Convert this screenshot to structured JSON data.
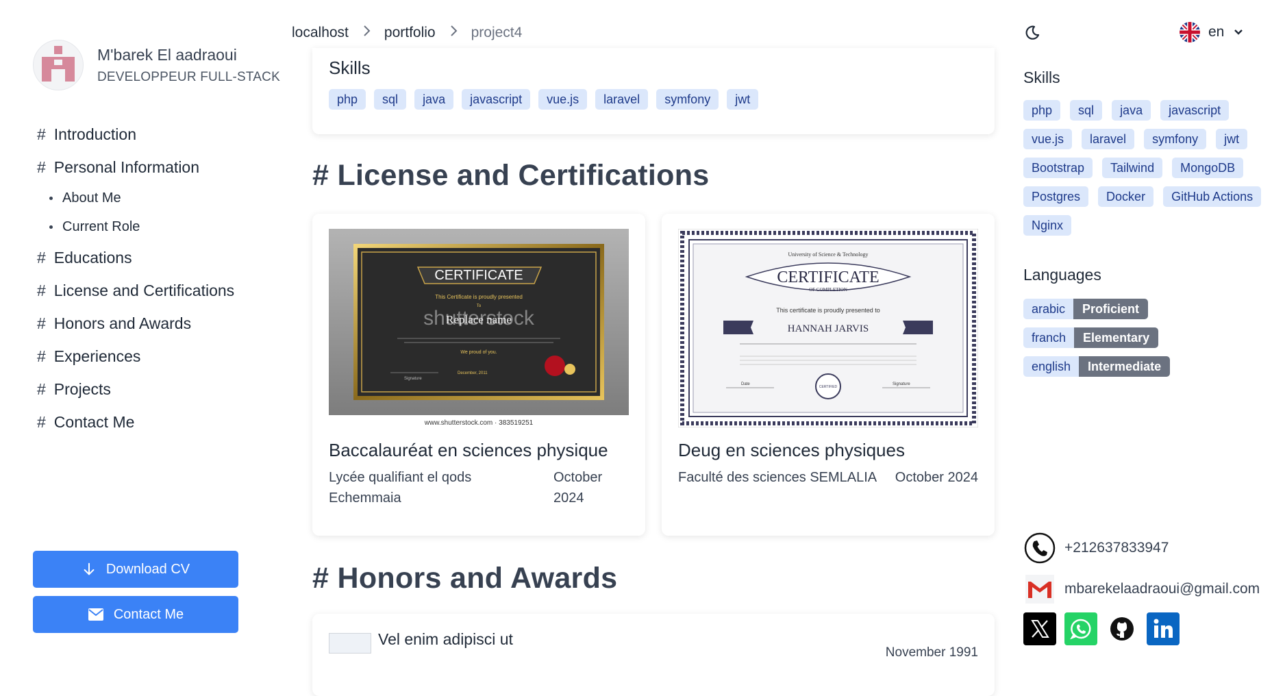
{
  "profile": {
    "name": "M'barek El aadraoui",
    "role": "DEVELOPPEUR FULL-STACK"
  },
  "nav": {
    "introduction": "Introduction",
    "personal_information": "Personal Information",
    "about_me": "About Me",
    "current_role": "Current Role",
    "educations": "Educations",
    "license": "License and Certifications",
    "honors": "Honors and Awards",
    "experiences": "Experiences",
    "projects": "Projects",
    "contact": "Contact Me",
    "hash": "#"
  },
  "buttons": {
    "download_cv": "Download CV",
    "contact_me": "Contact Me"
  },
  "breadcrumb": [
    "localhost",
    "portfolio",
    "project4"
  ],
  "language_selector": {
    "label": "en"
  },
  "main": {
    "skills_title": "Skills",
    "skills": [
      "php",
      "sql",
      "java",
      "javascript",
      "vue.js",
      "laravel",
      "symfony",
      "jwt"
    ],
    "license_heading": "# License and Certifications",
    "certifications": [
      {
        "title": "Baccalauréat en sciences physique",
        "school": "Lycée qualifiant el qods Echemmaia",
        "date": "October 2024",
        "image_text": {
          "heading": "CERTIFICATE",
          "line1": "This Certificate is proudly presented",
          "line2": "To",
          "name": "Replace name",
          "proud": "We proud of you.",
          "date": "December, 2011",
          "signature": "Signature",
          "watermark": "shutterstock",
          "credit": "www.shutterstock.com · 383519251"
        }
      },
      {
        "title": "Deug en sciences physiques",
        "school": "Faculté des sciences SEMLALIA",
        "date": "October 2024",
        "image_text": {
          "university": "University of Science & Technology",
          "heading": "CERTIFICATE",
          "subheading": "OF COMPLETION",
          "line1": "This certificate is proudly presented to",
          "name": "HANNAH JARVIS",
          "date_label": "Date",
          "signature": "Signature",
          "seal": "CERTIFIED"
        }
      }
    ],
    "honors_heading": "# Honors and Awards",
    "honor": {
      "title": "Vel enim adipisci ut",
      "date": "November 1991"
    }
  },
  "right": {
    "skills_title": "Skills",
    "skills": [
      "php",
      "sql",
      "java",
      "javascript",
      "vue.js",
      "laravel",
      "symfony",
      "jwt",
      "Bootstrap",
      "Tailwind",
      "MongoDB",
      "Postgres",
      "Docker",
      "GitHub Actions",
      "Nginx"
    ],
    "languages_title": "Languages",
    "languages": [
      {
        "name": "arabic",
        "level": "Proficient"
      },
      {
        "name": "franch",
        "level": "Elementary"
      },
      {
        "name": "english",
        "level": "Intermediate"
      }
    ],
    "phone": "+212637833947",
    "email": "mbarekelaadraoui@gmail.com",
    "socials": [
      "x-icon",
      "whatsapp-icon",
      "github-icon",
      "linkedin-icon"
    ]
  },
  "colors": {
    "accent": "#3b82f6",
    "tag_bg": "#dbe7fb",
    "tag_text": "#1e3a8a",
    "level_bg": "#6b7280"
  }
}
